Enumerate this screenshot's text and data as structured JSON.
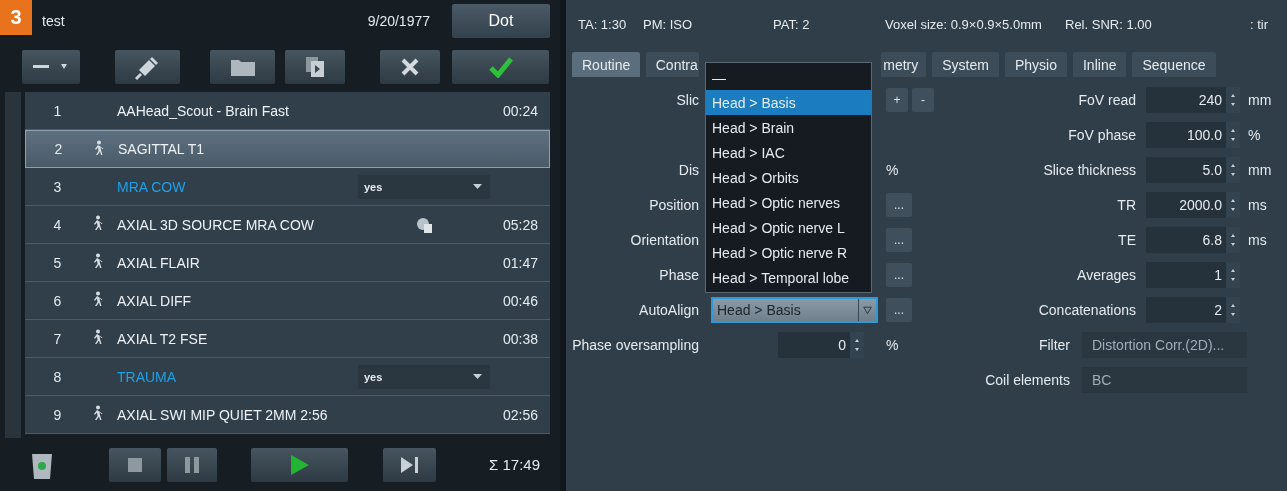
{
  "header": {
    "badge": "3",
    "title": "test",
    "date": "9/20/1977",
    "button": "Dot"
  },
  "protocols": [
    {
      "number": "1",
      "name": "AAHead_Scout - Brain Fast",
      "time": "00:24",
      "kind": "protocol",
      "runner_icon": false,
      "selected": false
    },
    {
      "number": "2",
      "name": "SAGITTAL T1",
      "kind": "protocol",
      "runner_icon": true,
      "selected": true
    },
    {
      "number": "3",
      "name": "MRA COW",
      "kind": "group",
      "option": "yes",
      "selected": false
    },
    {
      "number": "4",
      "name": "AXIAL 3D SOURCE MRA COW",
      "time": "05:28",
      "kind": "protocol",
      "runner_icon": true,
      "extra_icon": true,
      "selected": false
    },
    {
      "number": "5",
      "name": "AXIAL FLAIR",
      "time": "01:47",
      "kind": "protocol",
      "runner_icon": true,
      "selected": false
    },
    {
      "number": "6",
      "name": "AXIAL DIFF",
      "time": "00:46",
      "kind": "protocol",
      "runner_icon": true,
      "selected": false
    },
    {
      "number": "7",
      "name": "AXIAL T2 FSE",
      "time": "00:38",
      "kind": "protocol",
      "runner_icon": true,
      "selected": false
    },
    {
      "number": "8",
      "name": "TRAUMA",
      "kind": "group",
      "option": "yes",
      "selected": false
    },
    {
      "number": "9",
      "name": "AXIAL SWI MIP QUIET 2MM 2:56",
      "time": "02:56",
      "kind": "protocol",
      "runner_icon": true,
      "selected": false
    }
  ],
  "total": "Σ 17:49",
  "info_bar": [
    "TA: 1:30",
    "PM: ISO",
    "PAT: 2",
    "Voxel size: 0.9×0.9×5.0mm",
    "Rel. SNR: 1.00",
    ": tir"
  ],
  "tabs": [
    {
      "label": "Routine",
      "selected": true
    },
    {
      "label": "Contra",
      "selected": false
    },
    {
      "label": "metry",
      "selected": false
    },
    {
      "label": "System",
      "selected": false
    },
    {
      "label": "Physio",
      "selected": false
    },
    {
      "label": "Inline",
      "selected": false
    },
    {
      "label": "Sequence",
      "selected": false
    }
  ],
  "form_rows": [
    {
      "left": {
        "label": "Slic",
        "kind": "plusminus",
        "buttons": [
          "+",
          "-"
        ]
      },
      "right": {
        "label": "FoV read",
        "kind": "spin",
        "value": "240",
        "unit": "mm"
      }
    },
    {
      "right": {
        "label": "FoV phase",
        "kind": "spin",
        "value": "100.0",
        "unit": "%"
      }
    },
    {
      "left": {
        "label": "Dis",
        "kind": "unit",
        "unit": "%"
      },
      "right": {
        "label": "Slice thickness",
        "kind": "spin",
        "value": "5.0",
        "unit": "mm"
      }
    },
    {
      "left": {
        "label": "Position",
        "kind": "more",
        "button": "..."
      },
      "right": {
        "label": "TR",
        "kind": "spin",
        "value": "2000.0",
        "unit": "ms"
      }
    },
    {
      "left": {
        "label": "Orientation",
        "kind": "more",
        "button": "..."
      },
      "right": {
        "label": "TE",
        "kind": "spin",
        "value": "6.8",
        "unit": "ms"
      }
    },
    {
      "left": {
        "label": "Phase",
        "kind": "more",
        "button": "..."
      },
      "right": {
        "label": "Averages",
        "kind": "spin",
        "value": "1"
      }
    },
    {
      "left": {
        "label": "AutoAlign",
        "kind": "select",
        "value": "Head > Basis",
        "button": "..."
      },
      "right": {
        "label": "Concatenations",
        "kind": "spin",
        "value": "2"
      }
    },
    {
      "left": {
        "label": "Phase oversampling",
        "kind": "spin",
        "value": "0",
        "unit": "%"
      },
      "right": {
        "label": "Filter",
        "kind": "text",
        "value": "Distortion Corr.(2D)..."
      }
    },
    {
      "right": {
        "label": "Coil elements",
        "kind": "text",
        "value": "BC"
      }
    }
  ],
  "dropdown": [
    {
      "label": "—",
      "selected": false
    },
    {
      "label": "Head > Basis",
      "selected": true
    },
    {
      "label": "Head > Brain",
      "selected": false
    },
    {
      "label": "Head > IAC",
      "selected": false
    },
    {
      "label": "Head > Orbits",
      "selected": false
    },
    {
      "label": "Head > Optic nerves",
      "selected": false
    },
    {
      "label": "Head > Optic nerve L",
      "selected": false
    },
    {
      "label": "Head > Optic nerve R",
      "selected": false
    },
    {
      "label": "Head > Temporal lobe",
      "selected": false
    }
  ]
}
